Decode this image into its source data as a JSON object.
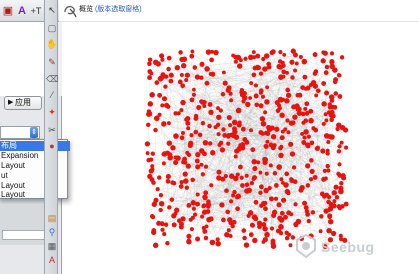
{
  "left_panel": {
    "toolbar": {
      "a_label": "A",
      "plus_t_label": "+T"
    },
    "apply_button": {
      "label": "应用"
    },
    "layout_select": {
      "stepper_icon": "up-down-arrows-icon"
    },
    "dropdown": {
      "items": [
        {
          "label": "布局",
          "selected": true
        },
        {
          "label": "Expansion",
          "selected": false
        },
        {
          "label": "Layout",
          "selected": false
        },
        {
          "label": "ut",
          "selected": false
        },
        {
          "label": "Layout",
          "selected": false
        },
        {
          "label": "Layout",
          "selected": false
        }
      ]
    }
  },
  "canvas": {
    "title": "概览",
    "title_note": "(版本选取窗格)"
  },
  "graph": {
    "node_color": "#e8130f",
    "edge_color": "#9a9a9a"
  },
  "watermark": {
    "text": "Seebug"
  }
}
